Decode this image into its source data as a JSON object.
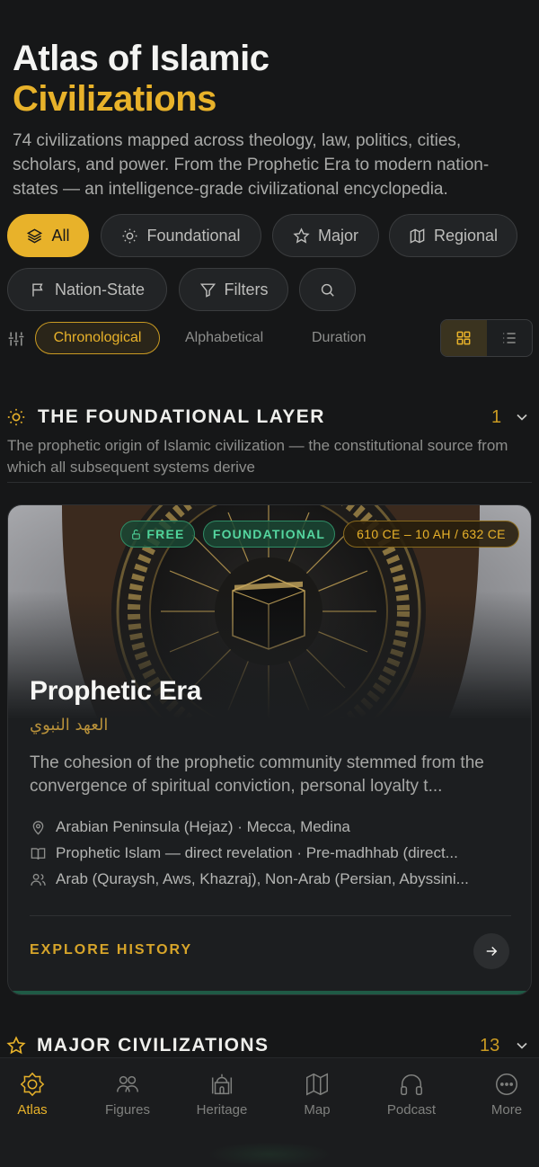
{
  "header": {
    "title_line1": "Atlas of Islamic",
    "title_line2": "Civilizations",
    "subtitle": "74 civilizations mapped across theology, law, politics, cities, scholars, and power. From the Prophetic Era to modern nation-states — an intelligence-grade civilizational encyclopedia."
  },
  "filters": {
    "chips": [
      {
        "label": "All",
        "icon": "layers-icon",
        "active": true
      },
      {
        "label": "Foundational",
        "icon": "sun-icon",
        "active": false
      },
      {
        "label": "Major",
        "icon": "star-icon",
        "active": false
      },
      {
        "label": "Regional",
        "icon": "map-icon",
        "active": false
      },
      {
        "label": "Nation-State",
        "icon": "flag-icon",
        "active": false
      },
      {
        "label": "Filters",
        "icon": "funnel-icon",
        "active": false
      }
    ],
    "search_icon": "search-icon"
  },
  "sort": {
    "options": [
      "Chronological",
      "Alphabetical",
      "Duration"
    ],
    "selected": "Chronological",
    "view_modes": [
      "grid",
      "list"
    ],
    "selected_view": "grid"
  },
  "sections": {
    "foundational": {
      "title": "THE FOUNDATIONAL LAYER",
      "count": "1",
      "description": "The prophetic origin of Islamic civilization — the constitutional source from which all subsequent systems derive"
    },
    "major": {
      "title": "MAJOR CIVILIZATIONS",
      "count": "13"
    }
  },
  "card": {
    "badges": {
      "free": "FREE",
      "type": "FOUNDATIONAL",
      "dates": "610 CE – 10 AH / 632 CE"
    },
    "title": "Prophetic Era",
    "arabic_title": "العهد النبوي",
    "description": "The cohesion of the prophetic community stemmed from the convergence of spiritual conviction, personal loyalty t...",
    "location": "Arabian Peninsula (Hejaz) · Mecca, Medina",
    "creed": "Prophetic Islam — direct revelation · Pre-madhhab (direct...",
    "peoples": "Arab (Quraysh, Aws, Khazraj), Non-Arab (Persian, Abyssini...",
    "cta": "EXPLORE HISTORY"
  },
  "bottom_nav": {
    "items": [
      {
        "label": "Atlas",
        "icon": "atlas-icon",
        "active": true
      },
      {
        "label": "Figures",
        "icon": "people-icon",
        "active": false
      },
      {
        "label": "Heritage",
        "icon": "mosque-icon",
        "active": false
      },
      {
        "label": "Map",
        "icon": "map-icon",
        "active": false
      },
      {
        "label": "Podcast",
        "icon": "headphones-icon",
        "active": false
      },
      {
        "label": "More",
        "icon": "more-icon",
        "active": false
      }
    ]
  },
  "colors": {
    "background": "#161718",
    "accent_gold": "#e8b22a",
    "accent_green": "#4fd39a",
    "text_muted": "#a9aaa8"
  }
}
